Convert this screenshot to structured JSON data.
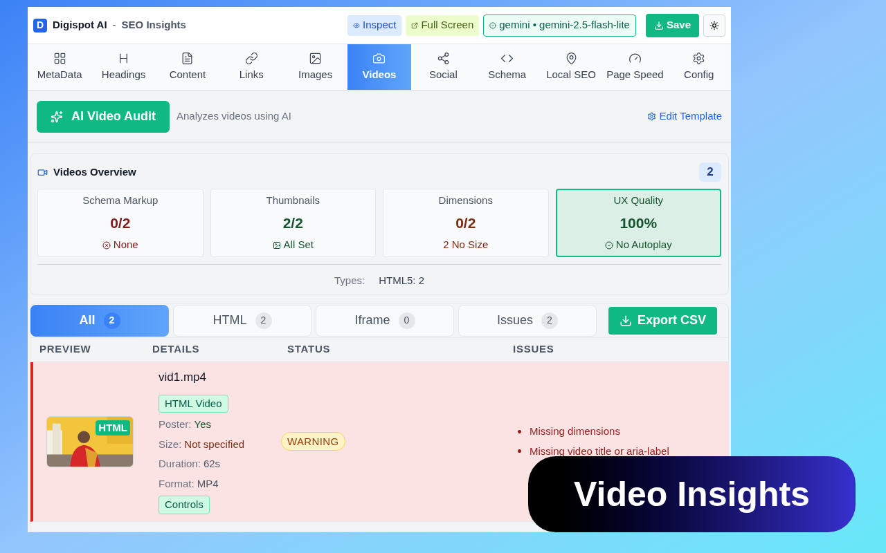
{
  "header": {
    "logo": "D",
    "brand": "Digispot AI",
    "separator": "-",
    "subtitle": "SEO Insights",
    "actions": [
      {
        "kind": "inspect",
        "label": "Inspect"
      },
      {
        "kind": "fullscreen",
        "label": "Full Screen"
      },
      {
        "kind": "model",
        "label": "gemini • gemini-2.5-flash-lite"
      },
      {
        "kind": "save",
        "label": "Save"
      },
      {
        "kind": "theme"
      }
    ]
  },
  "tabs": [
    {
      "label": "MetaData",
      "selected": false
    },
    {
      "label": "Headings",
      "selected": false
    },
    {
      "label": "Content",
      "selected": false
    },
    {
      "label": "Links",
      "selected": false
    },
    {
      "label": "Images",
      "selected": false
    },
    {
      "label": "Videos",
      "selected": true
    },
    {
      "label": "Social",
      "selected": false
    },
    {
      "label": "Schema",
      "selected": false
    },
    {
      "label": "Local SEO",
      "selected": false
    },
    {
      "label": "Page Speed",
      "selected": false
    },
    {
      "label": "Config",
      "selected": false
    }
  ],
  "audit": {
    "button": "AI Video Audit",
    "description": "Analyzes videos using AI",
    "edit": "Edit Template"
  },
  "overview": {
    "title": "Videos Overview",
    "count": "2",
    "cards": [
      {
        "label": "Schema Markup",
        "value": "0/2",
        "note": "None",
        "color": "#7f1d1d",
        "highlighted": false
      },
      {
        "label": "Thumbnails",
        "value": "2/2",
        "note": "All Set",
        "color": "#14532d",
        "highlighted": false
      },
      {
        "label": "Dimensions",
        "value": "0/2",
        "note": "2 No Size",
        "color": "#7c2d12",
        "highlighted": false
      },
      {
        "label": "UX Quality",
        "value": "100%",
        "note": "No Autoplay",
        "color": "#14532d",
        "highlighted": true
      }
    ],
    "types_label": "Types:",
    "types_value": "HTML5: 2"
  },
  "filters": [
    {
      "label": "All",
      "count": "2",
      "selected": true
    },
    {
      "label": "HTML",
      "count": "2",
      "selected": false
    },
    {
      "label": "Iframe",
      "count": "0",
      "selected": false
    },
    {
      "label": "Issues",
      "count": "2",
      "selected": false
    }
  ],
  "export": "Export CSV",
  "table": {
    "columns": [
      "PREVIEW",
      "DETAILS",
      "STATUS",
      "ISSUES"
    ],
    "rows": [
      {
        "preview_badge": "HTML",
        "name": "vid1.mp4",
        "type": "HTML Video",
        "details": [
          {
            "label": "Poster:",
            "value": "Yes",
            "color": "#14532d"
          },
          {
            "label": "Size:",
            "value": "Not specified",
            "color": "#7c2d12"
          },
          {
            "label": "Duration:",
            "value": "62s",
            "color": "#4b5563"
          },
          {
            "label": "Format:",
            "value": "MP4",
            "color": "#4b5563"
          }
        ],
        "tags": [
          "Controls"
        ],
        "status": "WARNING",
        "issues": [
          "Missing dimensions",
          "Missing video title or aria-label"
        ]
      }
    ]
  },
  "banner": "Video Insights"
}
